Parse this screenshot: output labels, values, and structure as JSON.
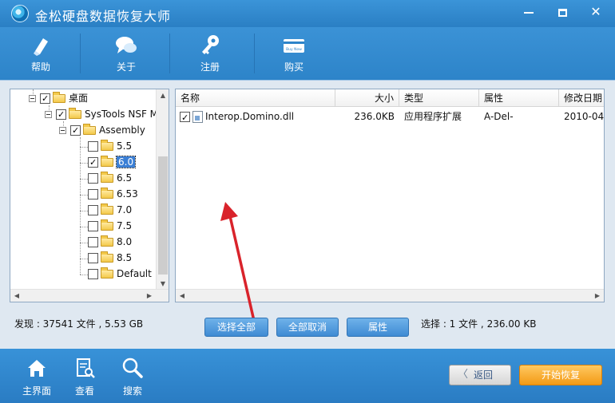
{
  "app": {
    "title": "金松硬盘数据恢复大师"
  },
  "toolbar": {
    "help": "帮助",
    "about": "关于",
    "register": "注册",
    "buy": "购买",
    "buy_badge": "Buy Now"
  },
  "tree": {
    "nodes": [
      {
        "label": "桌面",
        "checked": true
      },
      {
        "label": "SysTools NSF M",
        "checked": true
      },
      {
        "label": "Assembly",
        "checked": true
      },
      {
        "label": "5.5",
        "checked": false
      },
      {
        "label": "6.0",
        "checked": true,
        "selected": true
      },
      {
        "label": "6.5",
        "checked": false
      },
      {
        "label": "6.53",
        "checked": false
      },
      {
        "label": "7.0",
        "checked": false
      },
      {
        "label": "7.5",
        "checked": false
      },
      {
        "label": "8.0",
        "checked": false
      },
      {
        "label": "8.5",
        "checked": false
      },
      {
        "label": "Default",
        "checked": false
      }
    ]
  },
  "filelist": {
    "columns": [
      "名称",
      "大小",
      "类型",
      "属性",
      "修改日期"
    ],
    "rows": [
      {
        "name": "Interop.Domino.dll",
        "size": "236.0KB",
        "type": "应用程序扩展",
        "attr": "A-Del-",
        "date": "2010-04-",
        "checked": true
      }
    ]
  },
  "status": {
    "found": "发现 : 37541 文件 , 5.53 GB",
    "selected": "选择 : 1 文件 , 236.00 KB"
  },
  "actions": {
    "select_all": "选择全部",
    "deselect_all": "全部取消",
    "properties": "属性"
  },
  "bottombar": {
    "home": "主界面",
    "view": "查看",
    "search": "搜索",
    "back": "返回",
    "recover": "开始恢复"
  },
  "colors": {
    "chrome_blue": "#2f7fc5",
    "accent_orange": "#f39a15",
    "annotation_red": "#d9232b"
  }
}
